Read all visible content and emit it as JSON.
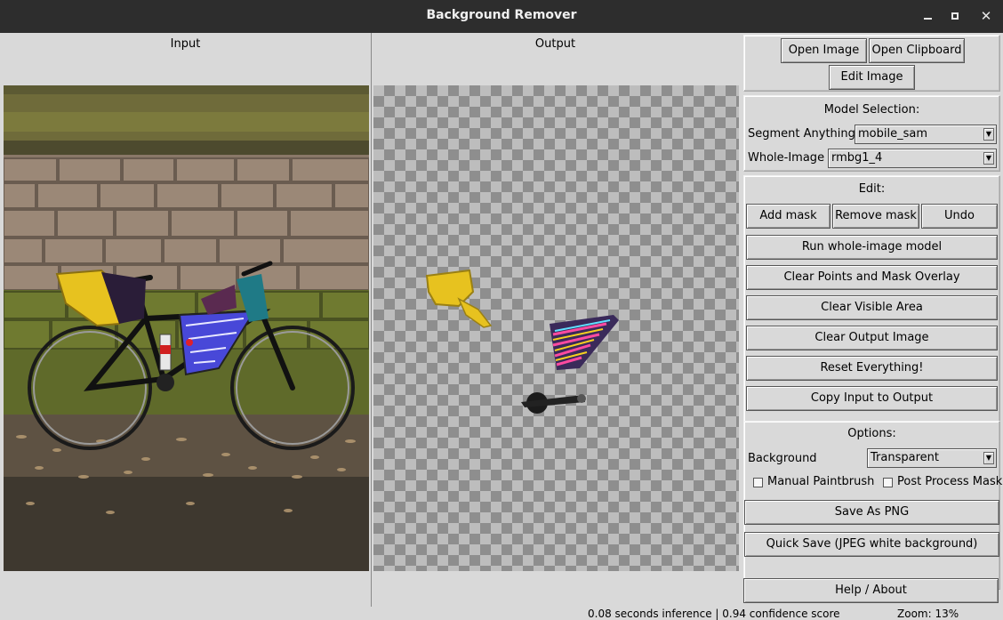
{
  "window": {
    "title": "Background Remover"
  },
  "panes": {
    "input_label": "Input",
    "output_label": "Output"
  },
  "controls": {
    "open_image": "Open Image",
    "open_clipboard": "Open Clipboard",
    "edit_image": "Edit Image",
    "model_heading": "Model Selection:",
    "segment_label": "Segment Anything",
    "segment_value": "mobile_sam",
    "whole_label": "Whole-Image",
    "whole_value": "rmbg1_4",
    "edit_heading": "Edit:",
    "add_mask": "Add mask",
    "remove_mask": "Remove mask",
    "undo": "Undo",
    "run_whole": "Run whole-image model",
    "clear_points": "Clear Points and Mask Overlay",
    "clear_visible": "Clear Visible Area",
    "clear_output": "Clear Output Image",
    "reset_everything": "Reset Everything!",
    "copy_input": "Copy Input to Output",
    "options_heading": "Options:",
    "background_label": "Background",
    "background_value": "Transparent",
    "manual_paintbrush": "Manual Paintbrush",
    "post_process_mask": "Post Process Mask",
    "save_png": "Save As PNG",
    "quick_save": "Quick Save (JPEG white background)",
    "help_about": "Help / About"
  },
  "status": {
    "inference": "0.08 seconds inference | 0.94 confidence score",
    "zoom": "Zoom: 13%"
  },
  "colors": {
    "titlebar": "#2d2d2d",
    "panel": "#d9d9d9",
    "marker": "#e0202a"
  }
}
